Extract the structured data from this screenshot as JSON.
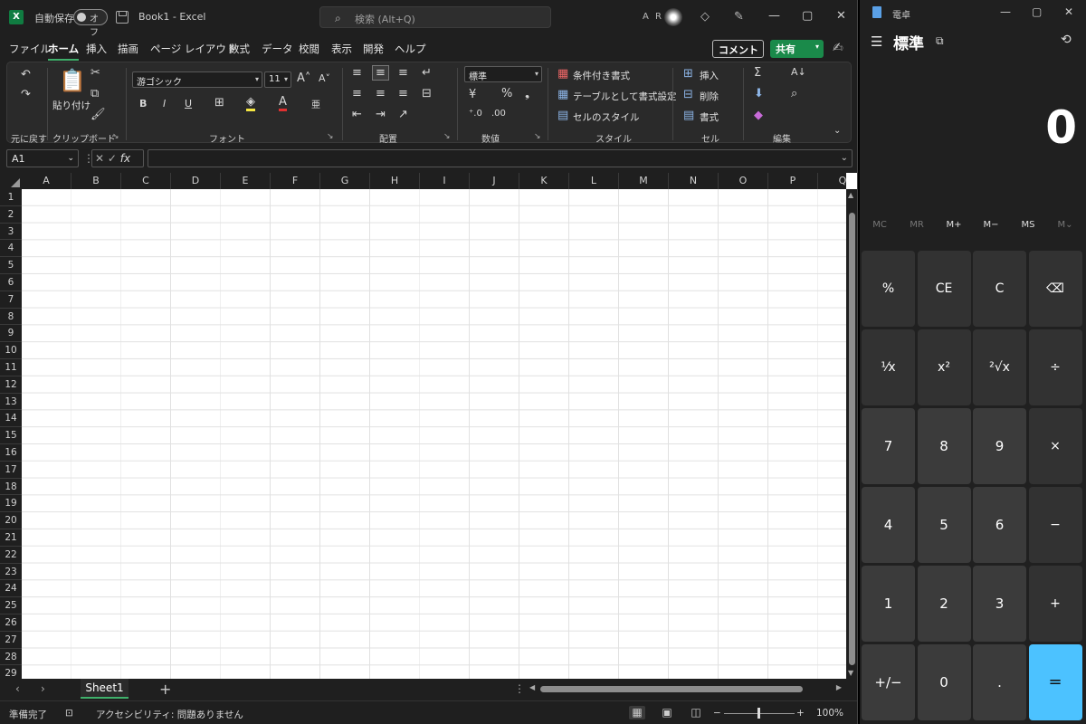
{
  "excel": {
    "titlebar": {
      "app_letter": "X",
      "autosave_label": "自動保存",
      "autosave_state": "オフ",
      "doc_title": "Book1 - Excel",
      "search_placeholder": "検索 (Alt+Q)",
      "user_initials": "A R",
      "minimize": "—",
      "maximize": "▢",
      "close": "✕"
    },
    "tabs": [
      "ファイル",
      "ホーム",
      "挿入",
      "描画",
      "ページ レイアウト",
      "数式",
      "データ",
      "校閲",
      "表示",
      "開発",
      "ヘルプ"
    ],
    "active_tab": "ホーム",
    "comment_label": "コメント",
    "share_label": "共有",
    "ribbon": {
      "groups": {
        "undo": "元に戻す",
        "clipboard": "クリップボード",
        "font": "フォント",
        "alignment": "配置",
        "number": "数値",
        "styles": "スタイル",
        "cells": "セル",
        "editing": "編集"
      },
      "paste_label": "貼り付け",
      "font_name": "游ゴシック",
      "font_size": "11",
      "number_format": "標準",
      "conditional_format": "条件付き書式",
      "format_as_table": "テーブルとして書式設定",
      "cell_styles": "セルのスタイル",
      "insert": "挿入",
      "delete": "削除",
      "format": "書式"
    },
    "name_box": "A1",
    "fx_label": "fx",
    "columns": [
      "A",
      "B",
      "C",
      "D",
      "E",
      "F",
      "G",
      "H",
      "I",
      "J",
      "K",
      "L",
      "M",
      "N",
      "O",
      "P",
      "Q"
    ],
    "rows": [
      "1",
      "2",
      "3",
      "4",
      "5",
      "6",
      "7",
      "8",
      "9",
      "10",
      "11",
      "12",
      "13",
      "14",
      "15",
      "16",
      "17",
      "18",
      "19",
      "20",
      "21",
      "22",
      "23",
      "24",
      "25",
      "26",
      "27",
      "28",
      "29"
    ],
    "sheet_tab": "Sheet1",
    "status": {
      "ready": "準備完了",
      "accessibility": "アクセシビリティ: 問題ありません",
      "zoom": "100%"
    }
  },
  "calculator": {
    "title": "電卓",
    "mode": "標準",
    "display": "0",
    "memory": [
      "MC",
      "MR",
      "M+",
      "M−",
      "MS",
      "M⌄"
    ],
    "keys": [
      "%",
      "CE",
      "C",
      "⌫",
      "¹⁄x",
      "x²",
      "²√x",
      "÷",
      "7",
      "8",
      "9",
      "×",
      "4",
      "5",
      "6",
      "−",
      "1",
      "2",
      "3",
      "+",
      "+/−",
      "0",
      ".",
      "="
    ]
  }
}
